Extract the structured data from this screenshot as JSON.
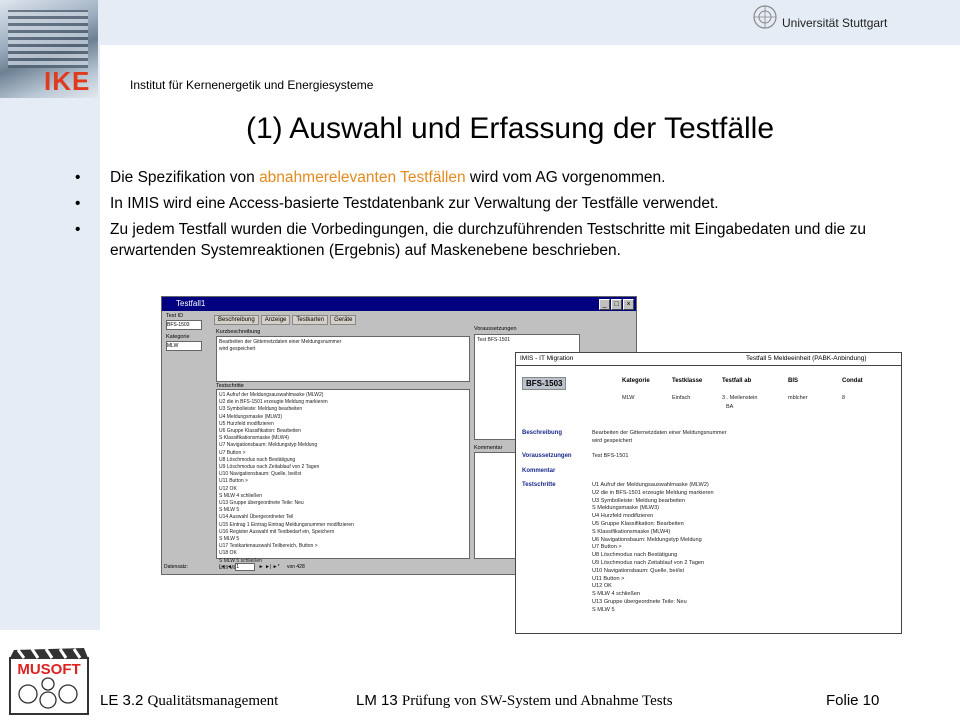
{
  "header": {
    "university": "Universität Stuttgart",
    "institute": "Institut für Kernenergetik und Energiesysteme",
    "logo_text": "IKE"
  },
  "slide": {
    "title": "(1) Auswahl und Erfassung der Testfälle",
    "bullets": [
      {
        "pre": "Die Spezifikation von ",
        "highlight": "abnahmerelevanten Testfällen",
        "post": " wird vom AG vorgenommen."
      },
      {
        "pre": "In IMIS wird eine Access-basierte Testdatenbank zur Verwaltung der Testfälle verwendet.",
        "highlight": "",
        "post": ""
      },
      {
        "pre": "Zu jedem Testfall wurden die Vorbedingungen, die durchzuführenden Testschritte mit Eingabedaten und die zu erwartenden Systemreaktionen (Ergebnis) auf Maskenebene beschrieben.",
        "highlight": "",
        "post": ""
      }
    ],
    "bullet_glyph": "•",
    "highlight_color": "#e58a1f"
  },
  "screenshot_form": {
    "window_title": "Testfall1",
    "tabs": [
      "Beschreibung",
      "Anzeige",
      "Testkarten",
      "Geräte"
    ],
    "field_label_1": "Test ID",
    "field_value_1": "BFS-1503",
    "field_label_2": "Kategorie",
    "field_value_2": "MLW",
    "panel_label_1": "Kurzbeschreibung",
    "panel_text_1": [
      "Bearbeiten der Gitternetzdaten einer Meldungsnummer",
      "wird gespeichert"
    ],
    "panel_label_2": "Voraussetzungen",
    "panel_text_2": [
      "Test BFS-1501"
    ],
    "panel_label_3": "Testschritte",
    "panel_label_4": "Kommentar",
    "steps": [
      "U1 Aufruf der Meldungsauswahlmaske (MLW2)",
      "U2 die in BFS-1501 erzeugte Meldung markieren",
      "U3 Symbolleiste: Meldung bearbeiten",
      "U4 Meldungsmaske (MLW3)",
      "U5 Hurzfeld modifizieren",
      "U6 Gruppe Klassifikation: Bearbeiten",
      "S Klassifikationsmaske (MLW4)",
      "U7 Navigationsbaum: Meldungstyp Meldung",
      "U7 Button >",
      "U8 Löschmodus nach Bestätigung",
      "U9 Löschmodus nach Zeitablauf von 2 Tagen",
      "U10 Navigationsbaum: Quelle, bei/ist",
      "U11 Button >",
      "U12 OK",
      "S MLW 4 schließen",
      "U13 Gruppe übergeordnete Teile: Neu",
      "S MLW 5",
      "U14 Auswahl Übergeordneter Teil",
      "U15 Eintrag 1 Eintrag Eintrag Meldungsnummer modifizieren",
      "U16 Register Auswahl mit Testbedarf ein, Speichern",
      "S MLW 5",
      "U17 Testkartenauswahl Teilbereich, Button >",
      "U18 OK",
      "S MLW 5 schließen",
      "U19 MLW 5 OK"
    ],
    "status_label": "Datensatz:",
    "status_value": "1",
    "status_total": "von 428"
  },
  "screenshot_report": {
    "header_left": "IMIS - IT Migration",
    "header_right": "Testfall 5 Meldeeinheit (PABK-Anbindung)",
    "test_id": "BFS-1503",
    "columns": [
      "Kategorie",
      "Testklasse",
      "Testfall ab",
      "BIS",
      "Condat"
    ],
    "values": [
      "MLW",
      "Einfach",
      "3 . Meilenstein",
      "mblcher",
      "8"
    ],
    "values_extra": "BA",
    "section_beschreibung": "Beschreibung",
    "text_beschreibung": [
      "Bearbeiten der Gitternetzdaten einer Meldungsnummer",
      "wird gespeichert"
    ],
    "section_voraussetzungen": "Voraussetzungen",
    "text_voraussetzungen": "Test BFS-1501",
    "section_kommentar": "Kommentar",
    "section_testschritte": "Testschritte",
    "steps": [
      "U1 Aufruf der Meldungsauswahlmaske (MLW2)",
      "U2 die in BFS-1501 erzeugte Meldung markieren",
      "U3 Symbolleiste: Meldung bearbeiten",
      "S Meldungsmaske (MLW3)",
      "U4 Hurzfeld modifizieren",
      "U5 Gruppe Klassifikation: Bearbeiten",
      "S Klassifikationsmaske (MLW4)",
      "U6 Navigationsbaum: Meldungstyp Meldung",
      "U7 Button >",
      "U8 Löschmodus nach Bestätigung",
      "U9 Löschmodus nach Zeitablauf von 2 Tagen",
      "U10 Navigationsbaum: Quelle, bei/ist",
      "U11 Button >",
      "U12 OK",
      "S MLW 4 schließen",
      "U13 Gruppe übergeordnete Teile: Neu",
      "S MLW 5"
    ]
  },
  "footer": {
    "le_prefix": "LE 3.2",
    "le_text": "Qualitätsmanagement",
    "lm_prefix": "LM 13",
    "lm_text": "Prüfung von SW-System und Abnahme Tests",
    "folie": "Folie 10",
    "logo_text": "MUSOFT"
  },
  "colors": {
    "band": "#e6ecf5",
    "ike_red": "#e13a1e",
    "highlight": "#e58a1f",
    "titlebar": "#000080"
  },
  "icons": [
    "university-logo-icon",
    "building-photo-icon",
    "musoft-logo-icon"
  ]
}
